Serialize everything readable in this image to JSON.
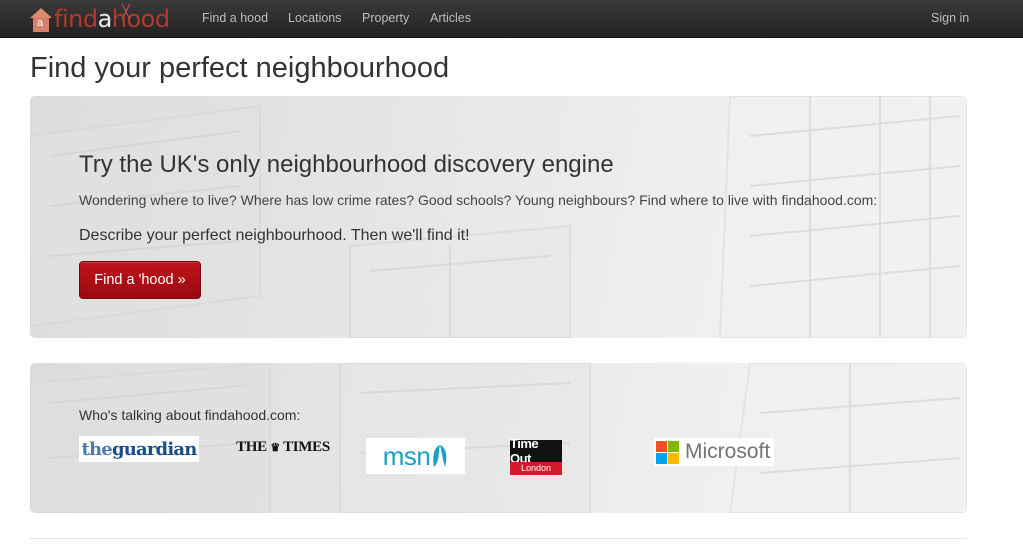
{
  "navbar": {
    "brand": {
      "part1": "find",
      "part2": "a",
      "part3": "hood"
    },
    "links": [
      "Find a hood",
      "Locations",
      "Property",
      "Articles"
    ],
    "signin": "Sign in"
  },
  "page_title": "Find your perfect neighbourhood",
  "hero": {
    "heading": "Try the UK's only neighbourhood discovery engine",
    "lead": "Wondering where to live? Where has low crime rates? Good schools? Young neighbours? Find where to live with findahood.com:",
    "sub": "Describe your perfect neighbourhood. Then we'll find it!",
    "button": "Find a 'hood »"
  },
  "press": {
    "label": "Who's talking about findahood.com:",
    "guardian_part1": "the",
    "guardian_part2": "guardian",
    "times_part1": "THE",
    "times_part2": "TIMES",
    "msn": "msn",
    "timeout_top": "Time Out",
    "timeout_bottom": "London",
    "microsoft": "Microsoft"
  },
  "colors": {
    "navbar": "#2b2b2b",
    "brand_red": "#b33a2c",
    "button_red": "#b0101a",
    "msn_blue": "#1aa0c4",
    "guardian_blue": "#1a4e8a",
    "ms_red": "#f25022",
    "ms_green": "#7fba00",
    "ms_blue": "#00a4ef",
    "ms_yellow": "#ffb900"
  }
}
